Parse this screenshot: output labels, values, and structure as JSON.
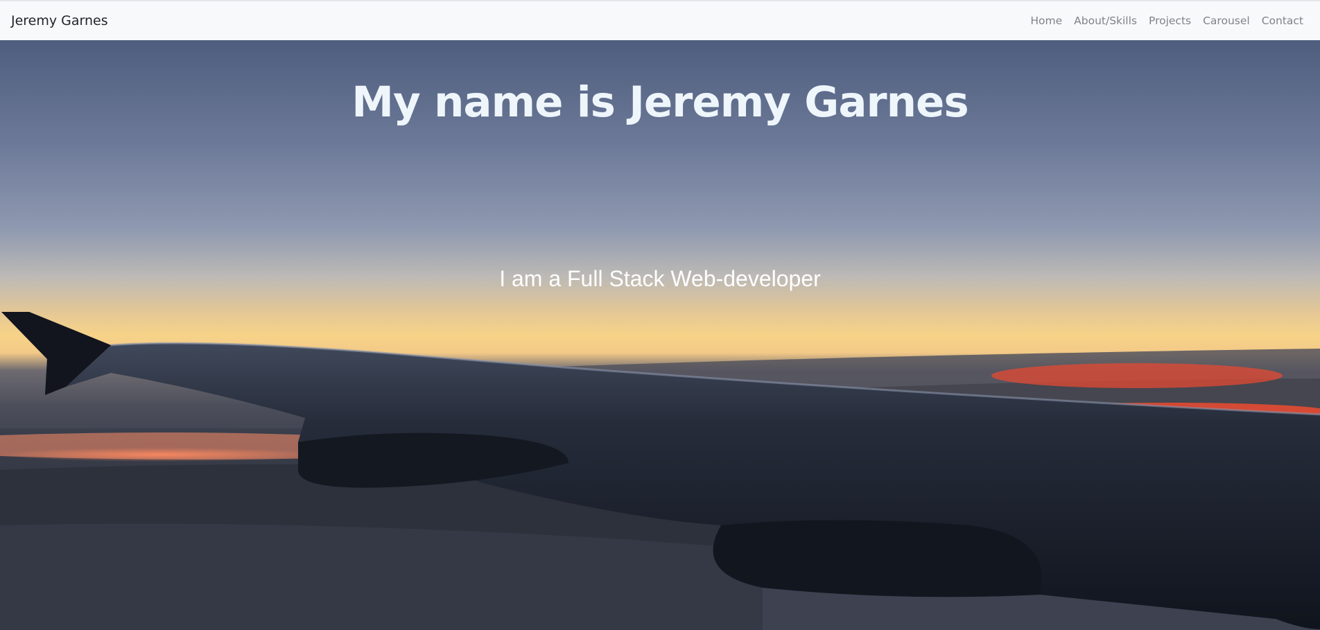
{
  "navbar": {
    "brand": "Jeremy Garnes",
    "links": [
      {
        "label": "Home"
      },
      {
        "label": "About/Skills"
      },
      {
        "label": "Projects"
      },
      {
        "label": "Carousel"
      },
      {
        "label": "Contact"
      }
    ]
  },
  "hero": {
    "title": "My name is Jeremy Garnes",
    "subtitle": "I am a Full Stack Web-developer",
    "background": "airplane-wing-sunset-photo"
  },
  "colors": {
    "navbar_bg": "#f8f9fa",
    "brand_text": "#212529",
    "nav_link_text": "#7f8388",
    "hero_text": "#ffffff"
  }
}
